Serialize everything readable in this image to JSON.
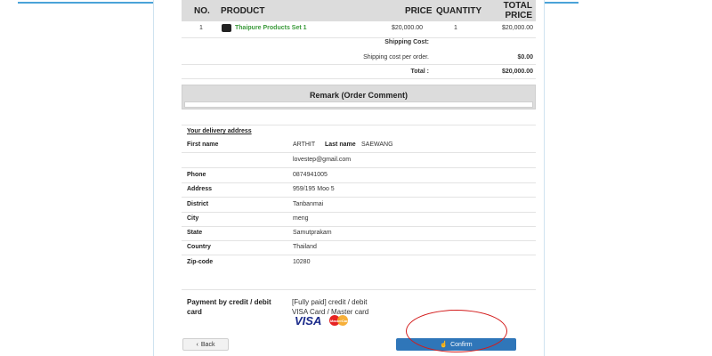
{
  "order_table": {
    "headers": {
      "no": "NO.",
      "product": "PRODUCT",
      "price": "PRICE",
      "quantity": "QUANTITY",
      "total_line1": "TOTAL",
      "total_line2": "PRICE"
    },
    "rows": [
      {
        "no": "1",
        "product": "Thaipure Products Set 1",
        "price": "$20,000.00",
        "quantity": "1",
        "total": "$20,000.00"
      }
    ],
    "shipping_cost_label": "Shipping Cost:",
    "shipping_per_order_label": "Shipping cost per order.",
    "shipping_per_order_value": "$0.00",
    "total_label": "Total :",
    "total_value": "$20,000.00"
  },
  "remark": {
    "title": "Remark (Order Comment)",
    "value": ""
  },
  "delivery": {
    "title": "Your delivery address",
    "first_name_label": "First name",
    "first_name": "ARTHIT",
    "last_name_label": "Last name",
    "last_name": "SAEWANG",
    "email": "lovestep@gmail.com",
    "phone_label": "Phone",
    "phone": "0874941005",
    "address_label": "Address",
    "address": "959/195 Moo 5",
    "district_label": "District",
    "district": "Tanbanmai",
    "city_label": "City",
    "city": "meng",
    "state_label": "State",
    "state": "Samutprakam",
    "country_label": "Country",
    "country": "Thailand",
    "zip_label": "Zip-code",
    "zip": "10280"
  },
  "payment": {
    "label": "Payment by credit / debit card",
    "line1": "[Fully paid] credit / debit",
    "line2": "VISA Card / Master card",
    "visa": "VISA",
    "mastercard": "MasterCard"
  },
  "buttons": {
    "back": "Back",
    "confirm": "Confirm",
    "back_icon": "chevron-left-icon",
    "confirm_icon": "pointer-icon"
  },
  "colors": {
    "accent": "#2f76b9",
    "product_link": "#3a9a3a",
    "highlight": "#d31b1b"
  }
}
